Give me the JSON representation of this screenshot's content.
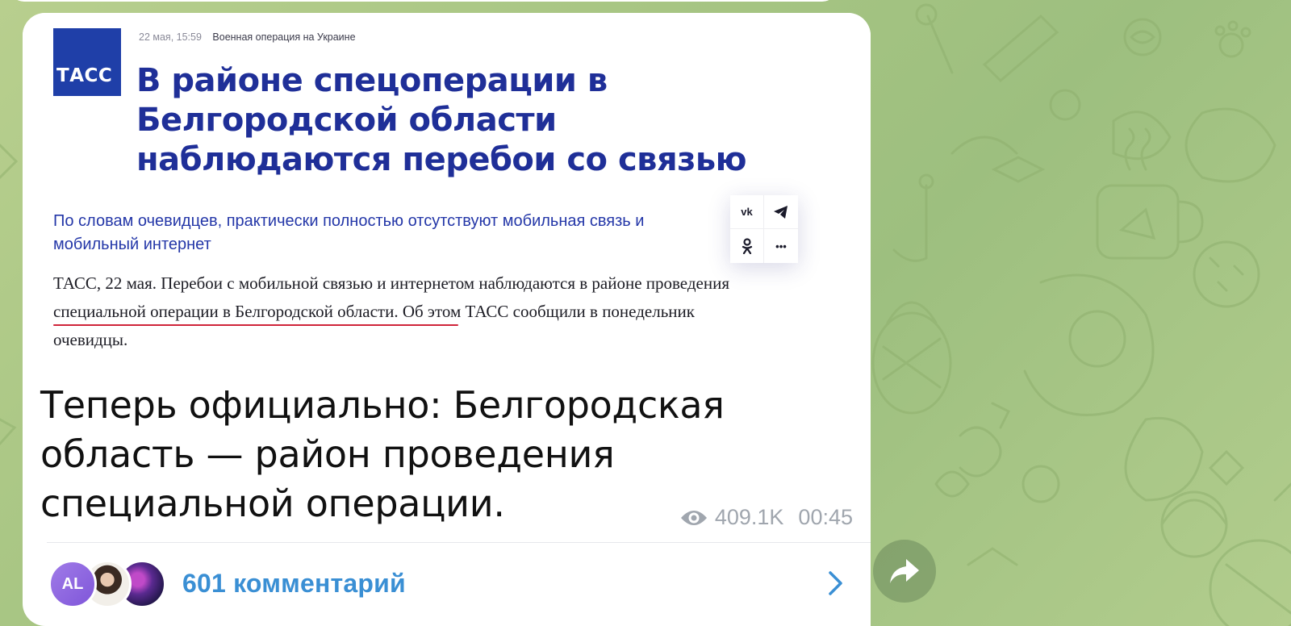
{
  "screenshot": {
    "logo_text": "ТАСС",
    "date": "22 мая, 15:59",
    "rubric": "Военная операция на Украине",
    "headline": "В районе спецоперации в Белгородской области наблюдаются перебои со связью",
    "lead": "По словам очевидцев, практически полностью отсутствуют мобильная связь и мобильный интернет",
    "share": {
      "vk_label": "vk",
      "more_label": "•••"
    },
    "article_text": "ТАСС, 22 мая. Перебои с мобильной связью и интернетом наблюдаются в районе проведения специальной операции в Белгородской области. Об этом ТАСС сообщили в понедельник очевидцы."
  },
  "post": {
    "caption": "Теперь официально: Белгородская область — район проведения специальной операции.",
    "views": "409.1K",
    "time": "00:45"
  },
  "comments": {
    "avatar_initials": "AL",
    "label": "601 комментарий"
  },
  "colors": {
    "tass_blue": "#1f3fa8",
    "link_blue": "#3a8fd4",
    "underline_red": "#d0243a"
  },
  "icons": [
    "eye-icon",
    "chevron-right-icon",
    "forward-icon",
    "vk-icon",
    "telegram-icon",
    "odnoklassniki-icon",
    "more-icon"
  ]
}
